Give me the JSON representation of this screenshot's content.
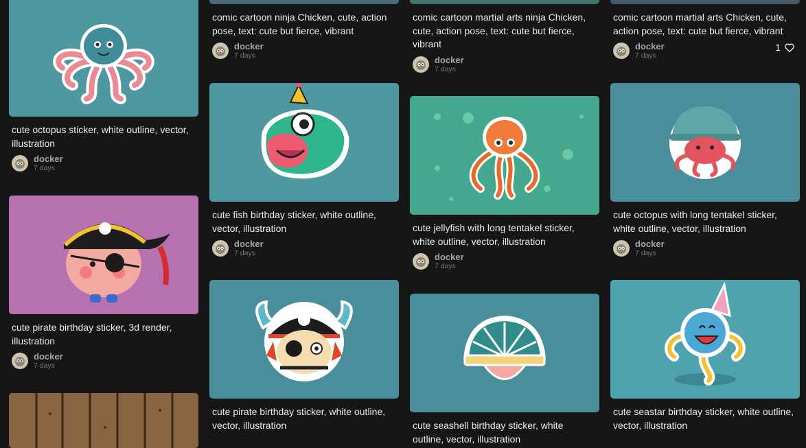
{
  "cards": {
    "c1": {
      "caption": "cute octopus sticker, white outline, vector, illustration",
      "user": "docker",
      "age": "7 days"
    },
    "c2": {
      "caption": "comic cartoon ninja Chicken, cute, action pose, text: cute but fierce, vibrant",
      "user": "docker",
      "age": "7 days"
    },
    "c3": {
      "caption": "comic cartoon martial arts ninja Chicken, cute, action pose, text: cute but fierce, vibrant",
      "user": "docker",
      "age": "7 days"
    },
    "c4": {
      "caption": "comic cartoon martial arts Chicken, cute, action pose, text: cute but fierce, vibrant",
      "user": "docker",
      "age": "7 days",
      "likes": "1"
    },
    "c5": {
      "caption": "cute pirate birthday sticker, 3d render, illustration",
      "user": "docker",
      "age": "7 days"
    },
    "c6": {
      "caption": "cute fish birthday sticker, white outline, vector, illustration",
      "user": "docker",
      "age": "7 days"
    },
    "c7": {
      "caption": "cute jellyfish with long tentakel sticker, white outline, vector, illustration",
      "user": "docker",
      "age": "7 days"
    },
    "c8": {
      "caption": "cute octopus with long tentakel sticker, white outline, vector, illustration",
      "user": "docker",
      "age": "7 days"
    },
    "c9": {
      "caption": "cute pirate birthday sticker, white outline, vector, illustration"
    },
    "c10": {
      "caption": "cute seashell birthday sticker, white outline, vector, illustration"
    },
    "c11": {
      "caption": "cute seastar birthday sticker, white outline, vector, illustration"
    }
  },
  "icons": {
    "avatar": "owl-avatar-icon",
    "like": "heart-icon"
  }
}
